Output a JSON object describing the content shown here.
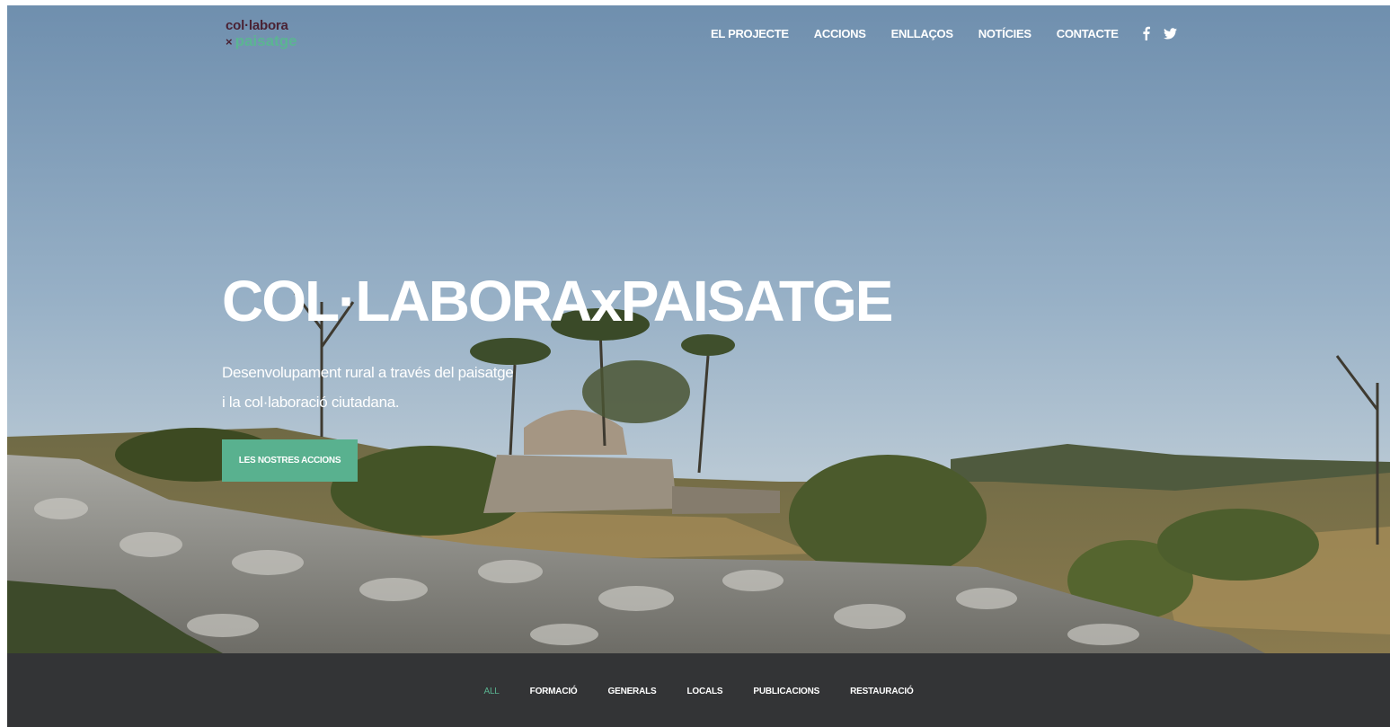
{
  "header": {
    "logo": {
      "line1": "col·labora",
      "x": "×",
      "line2": "paisatge"
    },
    "nav": [
      {
        "label": "EL PROJECTE"
      },
      {
        "label": "ACCIONS"
      },
      {
        "label": "ENLLAÇOS"
      },
      {
        "label": "NOTÍCIES"
      },
      {
        "label": "CONTACTE"
      }
    ],
    "social": [
      {
        "icon": "facebook-icon"
      },
      {
        "icon": "twitter-icon"
      }
    ]
  },
  "hero": {
    "title": "COL·LABORAxPAISATGE",
    "subtitle_line1": "Desenvolupament rural a través del paisatge",
    "subtitle_line2": "i la col·laboració ciutadana.",
    "cta_label": "LES NOSTRES ACCIONS",
    "background": "photo-dry-stone-walls-and-stone-hut"
  },
  "filters": {
    "items": [
      {
        "label": "ALL",
        "active": true
      },
      {
        "label": "FORMACIÓ",
        "active": false
      },
      {
        "label": "GENERALS",
        "active": false
      },
      {
        "label": "LOCALS",
        "active": false
      },
      {
        "label": "PUBLICACIONS",
        "active": false
      },
      {
        "label": "RESTAURACIÓ",
        "active": false
      }
    ]
  },
  "colors": {
    "accent": "#59b18f",
    "logo_dark": "#4a2233",
    "filter_bar": "#333436",
    "sky": "#8fa9c1"
  }
}
